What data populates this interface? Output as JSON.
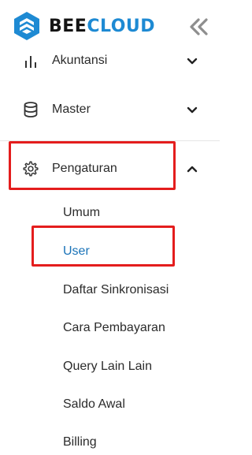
{
  "brand": {
    "part1": "BEE",
    "part2": "CLOUD",
    "accent": "#1e8ad3"
  },
  "nav": {
    "items": [
      {
        "label": "Akuntansi",
        "icon": "bar-chart-icon",
        "chevron": "chevron-down-icon"
      },
      {
        "label": "Master",
        "icon": "database-icon",
        "chevron": "chevron-down-icon"
      },
      {
        "label": "Pengaturan",
        "icon": "gear-icon",
        "chevron": "chevron-up-icon"
      }
    ],
    "settings_sub": [
      {
        "label": "Umum"
      },
      {
        "label": "User",
        "active": true
      },
      {
        "label": "Daftar Sinkronisasi"
      },
      {
        "label": "Cara Pembayaran"
      },
      {
        "label": "Query Lain Lain"
      },
      {
        "label": "Saldo Awal"
      },
      {
        "label": "Billing"
      }
    ]
  },
  "colors": {
    "active_link": "#1a73b8",
    "highlight_border": "#e41d1d"
  }
}
